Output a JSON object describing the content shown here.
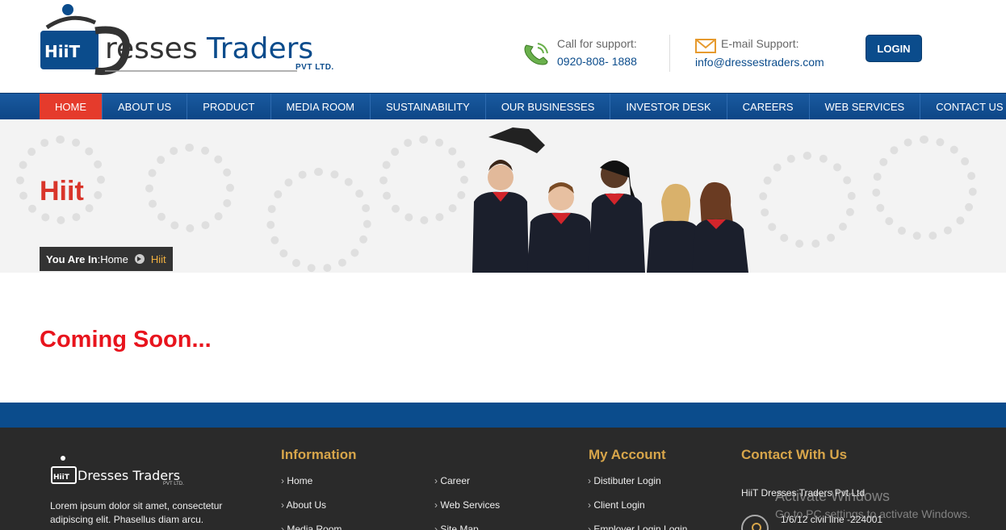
{
  "header": {
    "logo_name_dresses": "resses",
    "logo_name_traders": "Traders",
    "logo_sub": "PVT LTD.",
    "logo_badge": "HiiT",
    "support_label": "Call for support:",
    "support_value": "0920-808- 1888",
    "email_label": "E-mail Support:",
    "email_value": "info@dressestraders.com",
    "login_label": "LOGIN"
  },
  "nav": {
    "items": [
      "HOME",
      "ABOUT US",
      "PRODUCT",
      "MEDIA ROOM",
      "SUSTAINABILITY",
      "OUR BUSINESSES",
      "INVESTOR DESK",
      "CAREERS",
      "WEB SERVICES",
      "CONTACT US"
    ],
    "active": "HOME"
  },
  "banner": {
    "title": "Hiit",
    "crumb_you": "You Are In",
    "crumb_sep": " : ",
    "crumb_home": "Home",
    "crumb_current": "Hiit"
  },
  "main": {
    "message": "Coming Soon..."
  },
  "footer": {
    "logo_name": "Dresses Traders",
    "logo_sub": "PVT LTD.",
    "logo_badge": "HiiT",
    "about_text": "Lorem ipsum dolor sit amet, consectetur adipiscing elit. Phasellus diam arcu.",
    "information_heading": "Information",
    "information_col1": [
      "Home",
      "About Us",
      "Media Room"
    ],
    "information_col2": [
      "Career",
      "Web Services",
      "Site Map"
    ],
    "account_heading": "My Account",
    "account_items": [
      "Distibuter Login",
      "Client Login",
      "Employer Login Login"
    ],
    "contact_heading": "Contact With Us",
    "contact_company": "HiiT Dresses Traders Pvt Ltd",
    "contact_address": "1/6/12 civil line -224001",
    "watermark_title": "Activate Windows",
    "watermark_sub": "Go to PC settings to activate Windows."
  },
  "colors": {
    "brand_blue": "#0b4c8c",
    "accent_red": "#e53b2c",
    "heading_gold": "#d7a54a",
    "coming_red": "#e8141d"
  }
}
